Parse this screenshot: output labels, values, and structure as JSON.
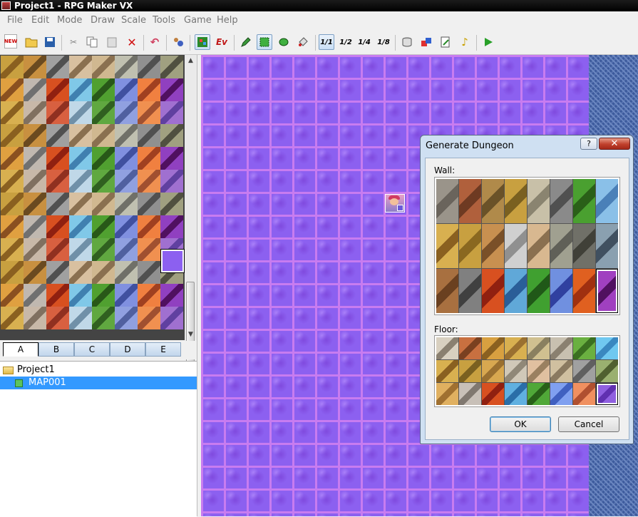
{
  "window": {
    "title": "Project1 - RPG Maker VX"
  },
  "menu": [
    "File",
    "Edit",
    "Mode",
    "Draw",
    "Scale",
    "Tools",
    "Game",
    "Help"
  ],
  "toolbar": {
    "new_label": "NEW",
    "event_label": "Ev",
    "scale_1_1": "1/1",
    "scale_1_2": "1/2",
    "scale_1_4": "1/4",
    "scale_1_8": "1/8"
  },
  "palette_tabs": [
    "A",
    "B",
    "C",
    "D",
    "E"
  ],
  "project_tree": {
    "root": "Project1",
    "maps": [
      "MAP001"
    ]
  },
  "dialog": {
    "title": "Generate Dungeon",
    "help_label": "?",
    "close_label": "✕",
    "wall_label": "Wall:",
    "floor_label": "Floor:",
    "ok_label": "OK",
    "cancel_label": "Cancel"
  },
  "colors": {
    "map_floor": "#8c60f0",
    "map_grout": "#c87cf0",
    "map_edge": "#3c5a9c",
    "dialog_frame": "#cfe0f2",
    "selection": "#3399ff"
  },
  "icons": {
    "new": "new-file-icon",
    "open": "open-folder-icon",
    "save": "save-disk-icon",
    "cut": "scissors-icon",
    "copy": "copy-icon",
    "paste": "paste-icon",
    "delete": "red-x-icon",
    "undo": "undo-icon",
    "play": "play-triangle-icon"
  }
}
